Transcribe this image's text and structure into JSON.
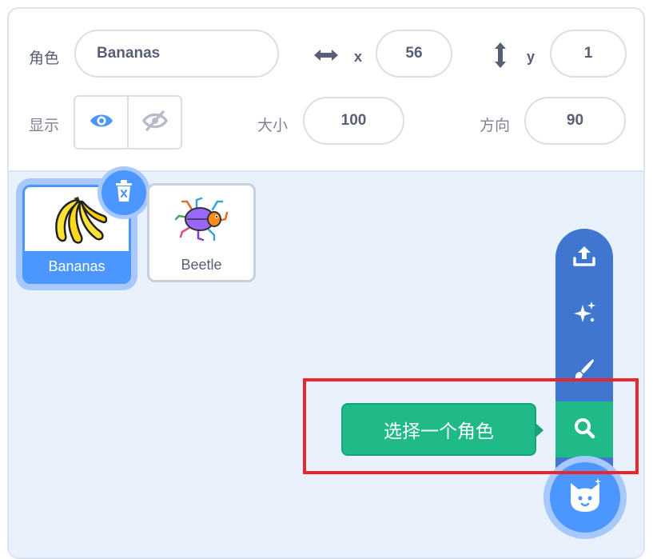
{
  "sprite_info": {
    "sprite_label": "角色",
    "sprite_name": "Bananas",
    "x_label": "x",
    "x_value": "56",
    "y_label": "y",
    "y_value": "1",
    "show_label": "显示",
    "size_label": "大小",
    "size_value": "100",
    "direction_label": "方向",
    "direction_value": "90"
  },
  "sprites": [
    {
      "name": "Bananas",
      "selected": true
    },
    {
      "name": "Beetle",
      "selected": false
    }
  ],
  "sprite_menu": {
    "items": [
      "upload-icon",
      "sparkle-icon",
      "paintbrush-icon",
      "search-icon"
    ],
    "tooltip": "选择一个角色",
    "main_button_icon": "cat-icon"
  },
  "colors": {
    "accent": "#4c97ff",
    "menu": "#4076d0",
    "active_green": "#1fba87",
    "highlight_red": "#e8272b"
  }
}
